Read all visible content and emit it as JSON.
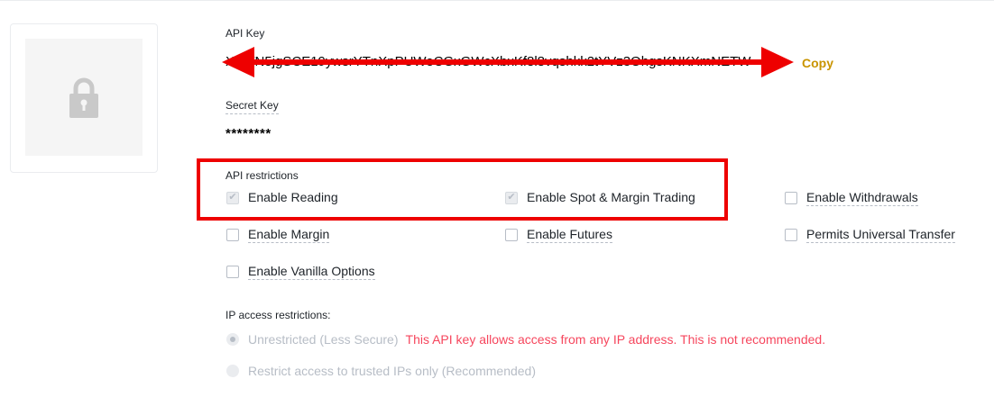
{
  "api_key": {
    "label": "API Key",
    "value": "XqIVN5jgSCE19ywsrYTnXpPUWeCGxGWcXbxKf8l8vqshkk2tYVz3OhgsKNKXmNETW",
    "copy_label": "Copy"
  },
  "secret_key": {
    "label": "Secret Key",
    "value": "********"
  },
  "restrictions": {
    "label": "API restrictions",
    "options": [
      {
        "label": "Enable Reading",
        "checked": true
      },
      {
        "label": "Enable Spot & Margin Trading",
        "checked": true
      },
      {
        "label": "Enable Withdrawals",
        "checked": false
      },
      {
        "label": "Enable Margin",
        "checked": false
      },
      {
        "label": "Enable Futures",
        "checked": false
      },
      {
        "label": "Permits Universal Transfer",
        "checked": false
      },
      {
        "label": "Enable Vanilla Options",
        "checked": false
      }
    ]
  },
  "ip_access": {
    "label": "IP access restrictions:",
    "options": [
      {
        "label": "Unrestricted (Less Secure)",
        "selected": true
      },
      {
        "label": "Restrict access to trusted IPs only (Recommended)",
        "selected": false
      }
    ],
    "warning": "This API key allows access from any IP address. This is not recommended."
  },
  "annotation_color": "#ee0000",
  "copy_color": "#c99400",
  "warning_color": "#f6465d"
}
